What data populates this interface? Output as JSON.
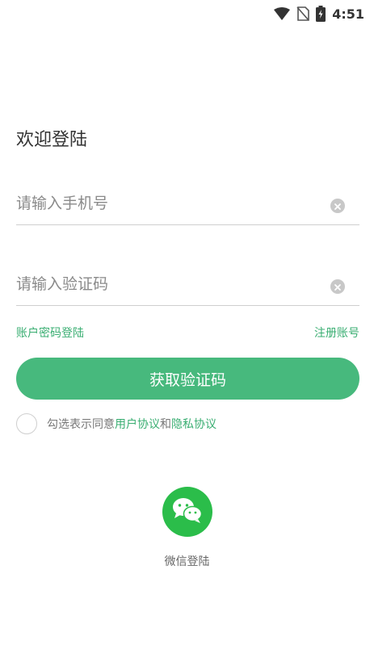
{
  "status_bar": {
    "time": "4:51"
  },
  "login": {
    "title": "欢迎登陆",
    "phone_placeholder": "请输入手机号",
    "code_placeholder": "请输入验证码",
    "password_login_link": "账户密码登陆",
    "register_link": "注册账号",
    "get_code_button": "获取验证码"
  },
  "agreement": {
    "prefix": "勾选表示同意",
    "user_agreement": "用户协议",
    "and": "和",
    "privacy_agreement": "隐私协议"
  },
  "social": {
    "wechat_label": "微信登陆"
  },
  "colors": {
    "accent": "#47b97d",
    "link": "#3aae72",
    "wechat": "#2bbd4a"
  }
}
